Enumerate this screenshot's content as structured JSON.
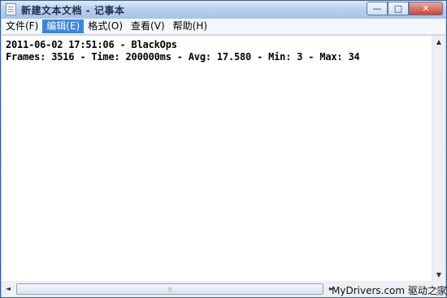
{
  "window": {
    "title": "新建文本文档 - 记事本",
    "icon": "notepad-icon",
    "controls": {
      "minimize": "—",
      "maximize": "□",
      "close": "✕"
    }
  },
  "menu": {
    "items": [
      {
        "label": "文件(F)",
        "active": false
      },
      {
        "label": "编辑(E)",
        "active": true
      },
      {
        "label": "格式(O)",
        "active": false
      },
      {
        "label": "查看(V)",
        "active": false
      },
      {
        "label": "帮助(H)",
        "active": false
      }
    ]
  },
  "document": {
    "lines": [
      "2011-06-02 17:51:06 - BlackOps",
      "Frames: 3516 - Time: 200000ms - Avg: 17.580 - Min: 3 - Max: 34"
    ]
  },
  "scrollbars": {
    "left_arrow": "◄",
    "right_arrow": "►",
    "up_arrow": "▲",
    "down_arrow": "▼",
    "grip": "⦙⦙⦙"
  },
  "watermark": "MyDrivers.com 驱动之家",
  "colors": {
    "menu_active": "#3d87d8",
    "close_button": "#c7463a"
  }
}
